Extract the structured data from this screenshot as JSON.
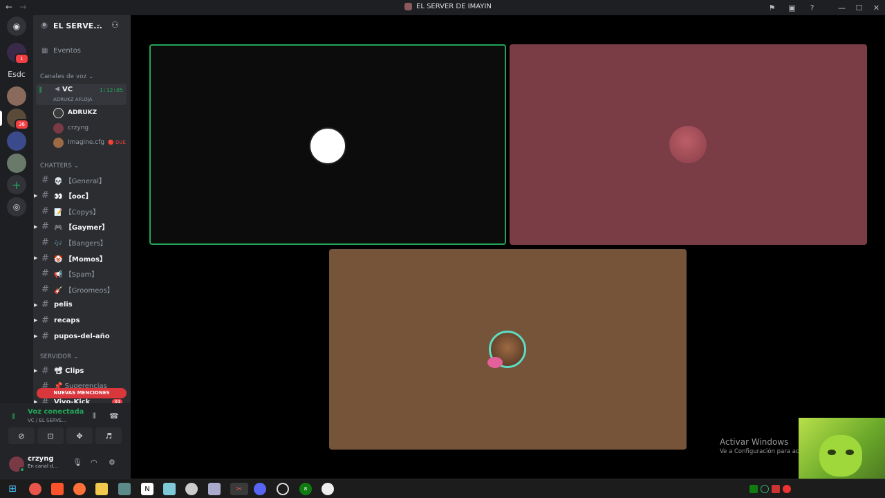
{
  "window": {
    "title": "EL SERVER DE IMAYIN",
    "nav_back": "←",
    "nav_forward": "→"
  },
  "guild_bar": {
    "dm_badge": "1",
    "folder_label": "Esdc",
    "server_badge": "36"
  },
  "server": {
    "name": "EL SERVE...",
    "boost_level": "0"
  },
  "sidebar": {
    "events_label": "Eventos",
    "voice_category": "Canales de voz",
    "voice_channel": {
      "name": "VC",
      "timer": "1:12:05",
      "status": "ADRUKZ AFLOJA",
      "members": [
        {
          "name": "ADRUKZ",
          "avatar_color": "#3a3a3a",
          "bold": true
        },
        {
          "name": "crzyng",
          "avatar_color": "#7a3a45",
          "bold": false
        },
        {
          "name": "Imagine.cfg",
          "avatar_color": "#9c6a44",
          "bold": false,
          "badge": "🔴 DUE"
        }
      ]
    },
    "chatters_category": "CHATTERS",
    "channels": [
      {
        "label": "💀 【General】",
        "unread": false,
        "arrow": false
      },
      {
        "label": "👀 【ooc】",
        "unread": true,
        "arrow": true
      },
      {
        "label": "📝 【Copys】",
        "unread": false,
        "arrow": false
      },
      {
        "label": "🎮 【Gaymer】",
        "unread": true,
        "arrow": true
      },
      {
        "label": "🎶 【Bangers】",
        "unread": false,
        "arrow": false
      },
      {
        "label": "🤡 【Momos】",
        "unread": true,
        "arrow": true
      },
      {
        "label": "📢 【Spam】",
        "unread": false,
        "arrow": false
      },
      {
        "label": "🎸 【Groomeos】",
        "unread": false,
        "arrow": false
      },
      {
        "label": "pelis",
        "unread": true,
        "arrow": true
      },
      {
        "label": "recaps",
        "unread": true,
        "arrow": true
      },
      {
        "label": "pupos-del-año",
        "unread": true,
        "arrow": true
      }
    ],
    "servidor_category": "SERVIDOR",
    "servidor_channels": [
      {
        "label": "📽 Clips",
        "unread": true,
        "arrow": true
      },
      {
        "label": "📌 Sugerencias",
        "unread": false,
        "arrow": false
      },
      {
        "label": "Vivo-Kick",
        "unread": true,
        "arrow": true
      }
    ],
    "mentions_banner": "NUEVAS MENCIONES",
    "mentions_count": "34"
  },
  "voice_panel": {
    "connected_label": "Voz conectada",
    "location": "VC / EL SERVE...",
    "username": "crzyng",
    "user_status": "En canal d..."
  },
  "stage": {
    "activate_title": "Activar Windows",
    "activate_sub": "Ve a Configuración para activar Windows."
  },
  "taskbar": {
    "xbox_badge": "8"
  }
}
